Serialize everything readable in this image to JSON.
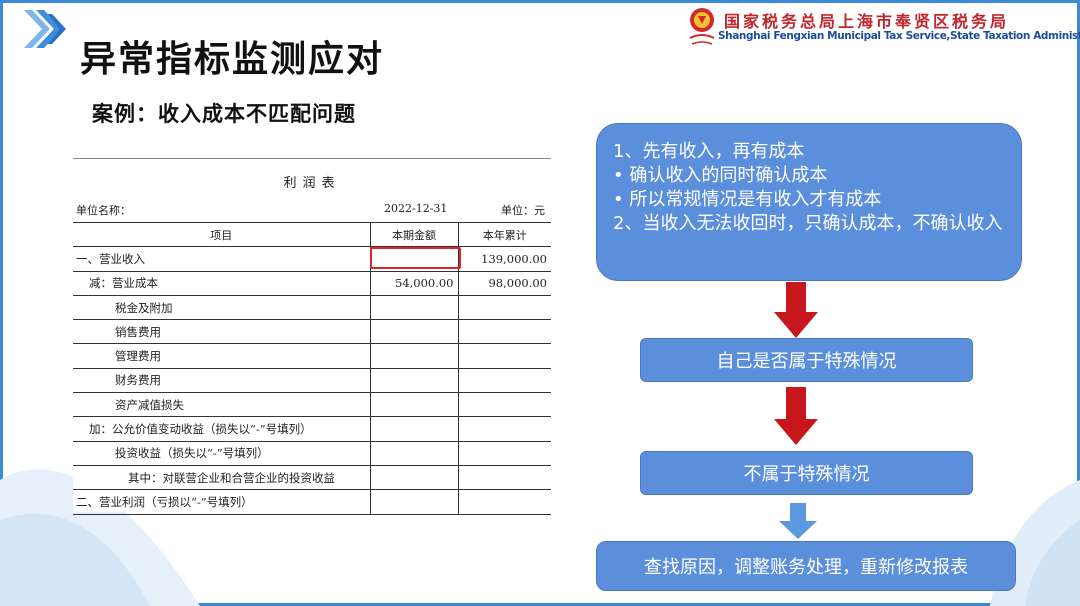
{
  "page": {
    "title": "异常指标监测应对",
    "subtitle": "案例：收入成本不匹配问题"
  },
  "org": {
    "name_cn": "国家税务总局上海市奉贤区税务局",
    "name_en": "Shanghai Fengxian Municipal Tax Service,State Taxation Administration"
  },
  "statement": {
    "title": "利润表",
    "unit_name_label": "单位名称：",
    "date": "2022-12-31",
    "unit_label": "单位：元",
    "headers": [
      "项目",
      "本期金额",
      "本年累计"
    ],
    "rows": [
      {
        "item": "一、营业收入",
        "current": "",
        "ytd": "139,000.00",
        "indent": 0
      },
      {
        "item": "减：营业成本",
        "current": "54,000.00",
        "ytd": "98,000.00",
        "indent": 1
      },
      {
        "item": "税金及附加",
        "current": "",
        "ytd": "",
        "indent": 3
      },
      {
        "item": "销售费用",
        "current": "",
        "ytd": "",
        "indent": 3
      },
      {
        "item": "管理费用",
        "current": "",
        "ytd": "",
        "indent": 3
      },
      {
        "item": "财务费用",
        "current": "",
        "ytd": "",
        "indent": 3
      },
      {
        "item": "资产减值损失",
        "current": "",
        "ytd": "",
        "indent": 3
      },
      {
        "item": "加：公允价值变动收益（损失以“-”号填列）",
        "current": "",
        "ytd": "",
        "indent": 1
      },
      {
        "item": "投资收益（损失以“-”号填列）",
        "current": "",
        "ytd": "",
        "indent": 3
      },
      {
        "item": "其中：对联营企业和合营企业的投资收益",
        "current": "",
        "ytd": "",
        "indent": 4
      },
      {
        "item": "二、营业利润（亏损以“-”号填列）",
        "current": "",
        "ytd": "",
        "indent": 0
      }
    ]
  },
  "flow": {
    "top_lines": [
      "1、先有收入，再有成本",
      "•   确认收入的同时确认成本",
      "•   所以常规情况是有收入才有成本",
      "2、当收入无法收回时，只确认成本，不确认收入"
    ],
    "step1": "自己是否属于特殊情况",
    "step2": "不属于特殊情况",
    "step3": "查找原因，调整账务处理，重新修改报表"
  },
  "colors": {
    "accent_blue": "#5b8fdb",
    "frame_blue": "#3b8ad8",
    "arrow_red": "#c8161d",
    "arrow_light": "#5b9ae0",
    "highlight_red": "#e2232a",
    "org_red": "#c0262c",
    "org_blue": "#1e4c9a"
  },
  "icons": [
    "chevron-right-icon",
    "tax-emblem-icon",
    "arrow-down-icon"
  ]
}
